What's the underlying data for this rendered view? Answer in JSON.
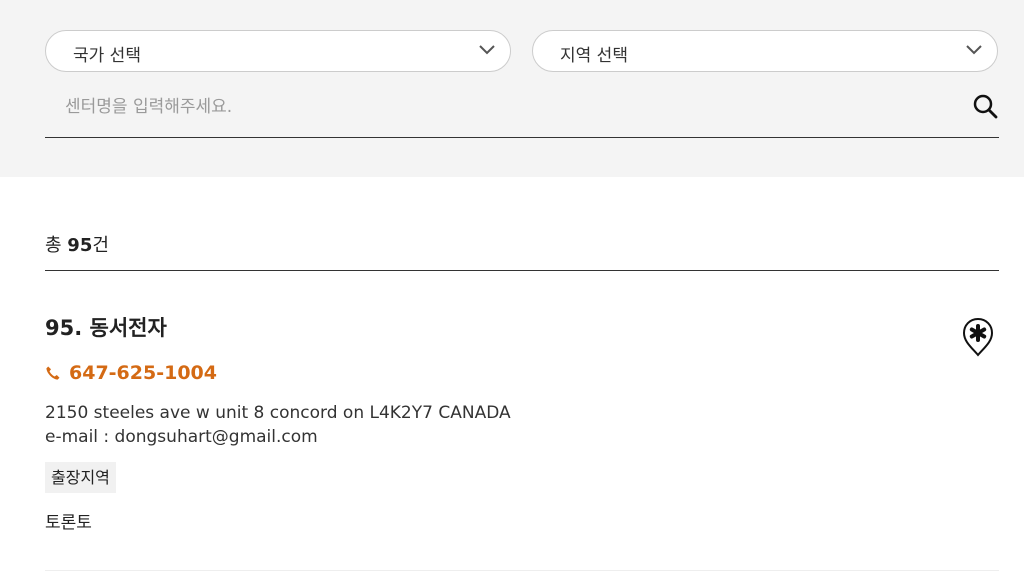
{
  "filters": {
    "country_select": {
      "label": "국가 선택"
    },
    "region_select": {
      "label": "지역 선택"
    },
    "search": {
      "placeholder": "센터명을 입력해주세요.",
      "value": ""
    }
  },
  "results": {
    "count_prefix": "총 ",
    "count_value": "95",
    "count_suffix": "건"
  },
  "center": {
    "title": "95. 동서전자",
    "phone": "647-625-1004",
    "address": "2150 steeles ave w unit 8 concord on L4K2Y7 CANADA",
    "email": "e-mail : dongsuhart@gmail.com",
    "service_area_label": "출장지역",
    "service_area_value": "토론토"
  },
  "colors": {
    "accent": "#d46a14",
    "panel_background": "#f4f4f4"
  },
  "icons": {
    "select_chevron": "chevron-down-icon",
    "search": "search-icon",
    "phone": "phone-icon",
    "favorite": "favorite-star-pin-icon"
  }
}
